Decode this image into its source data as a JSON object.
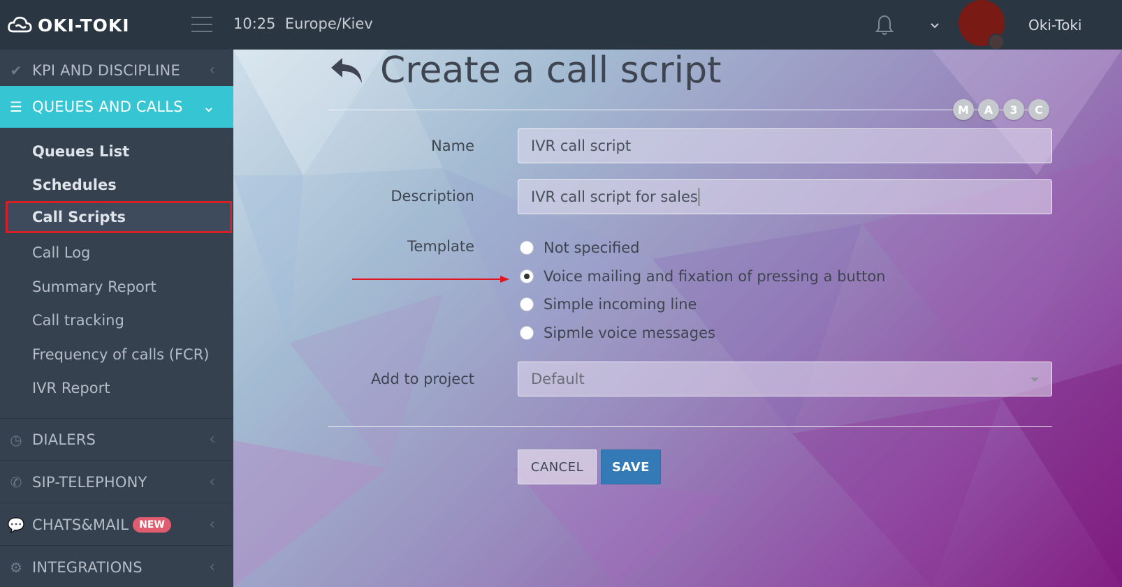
{
  "header": {
    "logo_text": "OKI-TOKI",
    "time": "10:25",
    "timezone": "Europe/Kiev",
    "username": "Oki-Toki"
  },
  "sidebar": {
    "sections": [
      {
        "label": "KPI AND DISCIPLINE",
        "icon": "check-icon"
      },
      {
        "label": "QUEUES AND CALLS",
        "icon": "list-icon",
        "active": true
      }
    ],
    "sub_items": [
      {
        "label": "Queues List"
      },
      {
        "label": "Schedules"
      },
      {
        "label": "Call Scripts",
        "selected": true
      },
      {
        "label": "Call Log"
      },
      {
        "label": "Summary Report"
      },
      {
        "label": "Call tracking"
      },
      {
        "label": "Frequency of calls (FCR)"
      },
      {
        "label": "IVR Report"
      }
    ],
    "lower_sections": [
      {
        "label": "DIALERS",
        "icon": "clock-icon"
      },
      {
        "label": "SIP-TELEPHONY",
        "icon": "phone-icon"
      },
      {
        "label": "CHATS&MAIL",
        "icon": "chat-icon",
        "badge": "NEW"
      },
      {
        "label": "INTEGRATIONS",
        "icon": "gears-icon"
      }
    ]
  },
  "main": {
    "title": "Create a call script",
    "chips": [
      "M",
      "A",
      "3",
      "C"
    ],
    "form": {
      "name_label": "Name",
      "name_value": "IVR call script",
      "description_label": "Description",
      "description_value": "IVR call script for sales",
      "template_label": "Template",
      "template_options": [
        {
          "label": "Not specified",
          "checked": false
        },
        {
          "label": "Voice mailing and fixation of pressing a button",
          "checked": true
        },
        {
          "label": "Simple incoming line",
          "checked": false
        },
        {
          "label": "Sipmle voice messages",
          "checked": false
        }
      ],
      "project_label": "Add to project",
      "project_value": "Default"
    },
    "buttons": {
      "cancel": "CANCEL",
      "save": "SAVE"
    }
  },
  "colors": {
    "topbar": "#2b3643",
    "sidebar": "#364150",
    "active_section": "#36c6d3",
    "save_button": "#337ab7",
    "highlight_border": "#d61f26",
    "badge_new": "#e05d6f"
  }
}
